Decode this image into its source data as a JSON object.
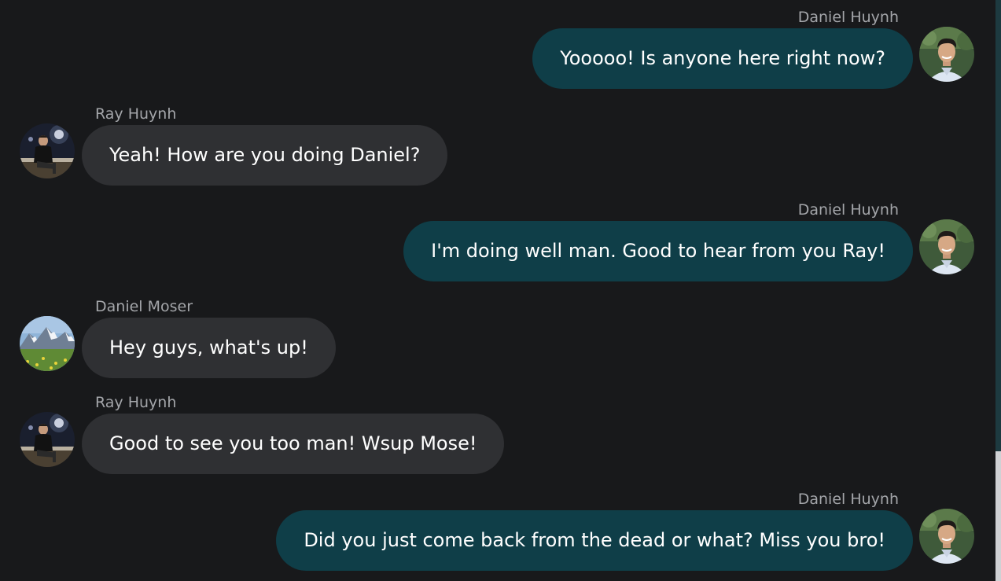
{
  "messages": [
    {
      "sender": "Daniel Huynh",
      "text": "Yooooo! Is anyone here right now?",
      "direction": "outgoing",
      "avatar": "daniel-huynh-avatar"
    },
    {
      "sender": "Ray Huynh",
      "text": "Yeah! How are you doing Daniel?",
      "direction": "incoming",
      "avatar": "ray-huynh-avatar"
    },
    {
      "sender": "Daniel Huynh",
      "text": "I'm doing well man. Good to hear from you Ray!",
      "direction": "outgoing",
      "avatar": "daniel-huynh-avatar"
    },
    {
      "sender": "Daniel Moser",
      "text": "Hey guys, what's up!",
      "direction": "incoming",
      "avatar": "daniel-moser-avatar"
    },
    {
      "sender": "Ray Huynh",
      "text": "Good to see you too man! Wsup Mose!",
      "direction": "incoming",
      "avatar": "ray-huynh-avatar"
    },
    {
      "sender": "Daniel Huynh",
      "text": "Did you just come back from the dead or what? Miss you bro!",
      "direction": "outgoing",
      "avatar": "daniel-huynh-avatar"
    }
  ],
  "colors": {
    "background": "#18191b",
    "outgoing_bubble": "#0f3e48",
    "incoming_bubble": "#2f3033",
    "sender_name": "#a4a6aa",
    "message_text": "#ffffff"
  }
}
